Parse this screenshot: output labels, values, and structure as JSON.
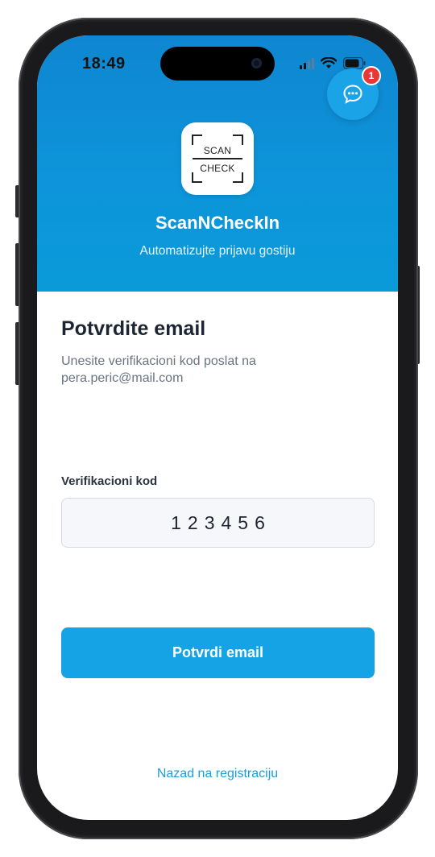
{
  "status_bar": {
    "time": "18:49"
  },
  "chat": {
    "badge_count": "1",
    "icon": "chat-bubble-icon"
  },
  "logo": {
    "line1": "SCAN",
    "line2": "CHECK"
  },
  "header": {
    "app_name": "ScanNCheckIn",
    "tagline": "Automatizujte prijavu gostiju"
  },
  "form": {
    "title": "Potvrdite email",
    "subtitle": "Unesite verifikacioni kod poslat na pera.peric@mail.com",
    "code_label": "Verifikacioni kod",
    "code_value": "123456",
    "submit_label": "Potvrdi email",
    "back_link": "Nazad na registraciju"
  },
  "colors": {
    "brand": "#0f8fd8",
    "button": "#16a3e5",
    "badge": "#e53935",
    "link": "#1a9dd9"
  }
}
